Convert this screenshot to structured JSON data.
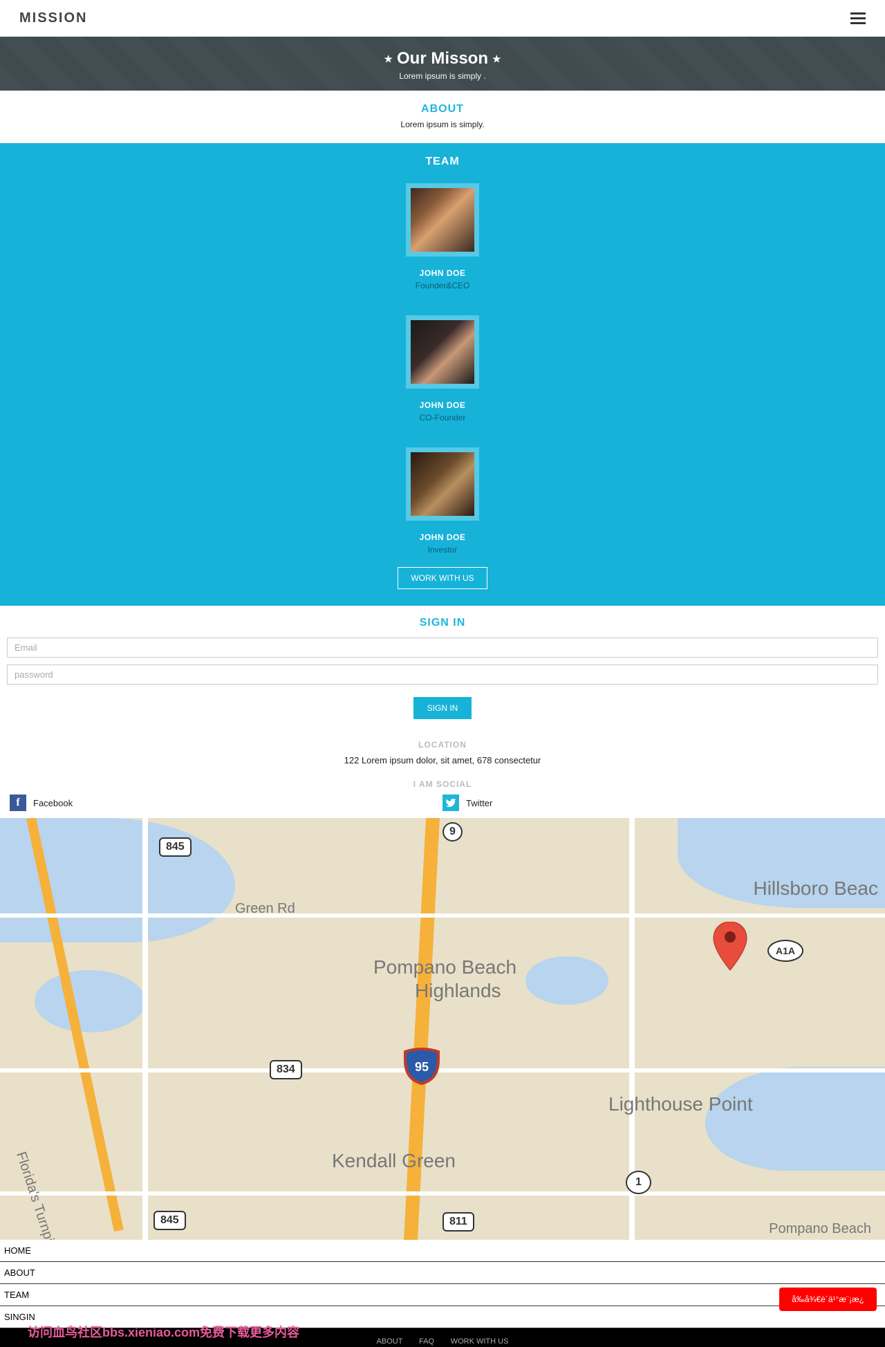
{
  "header": {
    "logo": "MISSION"
  },
  "hero": {
    "title": "Our Misson",
    "subtitle": "Lorem ipsum is simply ."
  },
  "about": {
    "heading": "ABOUT",
    "text": "Lorem ipsum is simply."
  },
  "team": {
    "heading": "TEAM",
    "members": [
      {
        "name": "JOHN DOE",
        "role": "Founder&CEO"
      },
      {
        "name": "JOHN DOE",
        "role": "CO-Founder"
      },
      {
        "name": "JOHN DOE",
        "role": "Investor"
      }
    ],
    "cta": "WORK WITH US"
  },
  "signin": {
    "heading": "SIGN IN",
    "email_placeholder": "Email",
    "password_placeholder": "password",
    "button": "SIGN IN"
  },
  "location": {
    "heading": "LOCATION",
    "address": "122 Lorem ipsum dolor, sit amet, 678 consectetur"
  },
  "social": {
    "heading": "I AM SOCIAL",
    "facebook": "Facebook",
    "twitter": "Twitter"
  },
  "map": {
    "labels": {
      "hillsboro": "Hillsboro Beac",
      "pompano": "Pompano Beach",
      "highlands": "Highlands",
      "lighthouse": "Lighthouse Point",
      "kendall": "Kendall Green",
      "greenrd": "Green Rd",
      "pompano2": "Pompano Beach",
      "florida": "Florida's Turnpike"
    },
    "shields": {
      "s845a": "845",
      "s845b": "845",
      "s834": "834",
      "s811": "811",
      "s9": "9",
      "s1": "1",
      "sA1A": "A1A",
      "s95": "95"
    }
  },
  "footer": {
    "nav": [
      "HOME",
      "ABOUT",
      "TEAM",
      "SINGIN"
    ],
    "links": [
      "ABOUT",
      "FAQ",
      "WORK WITH US"
    ],
    "watermark": "访问血鸟社区bbs.xieniao.com免费下载更多内容"
  },
  "red_button": "å‰å¾€è´­ä¹°æ¨¡æ¿"
}
